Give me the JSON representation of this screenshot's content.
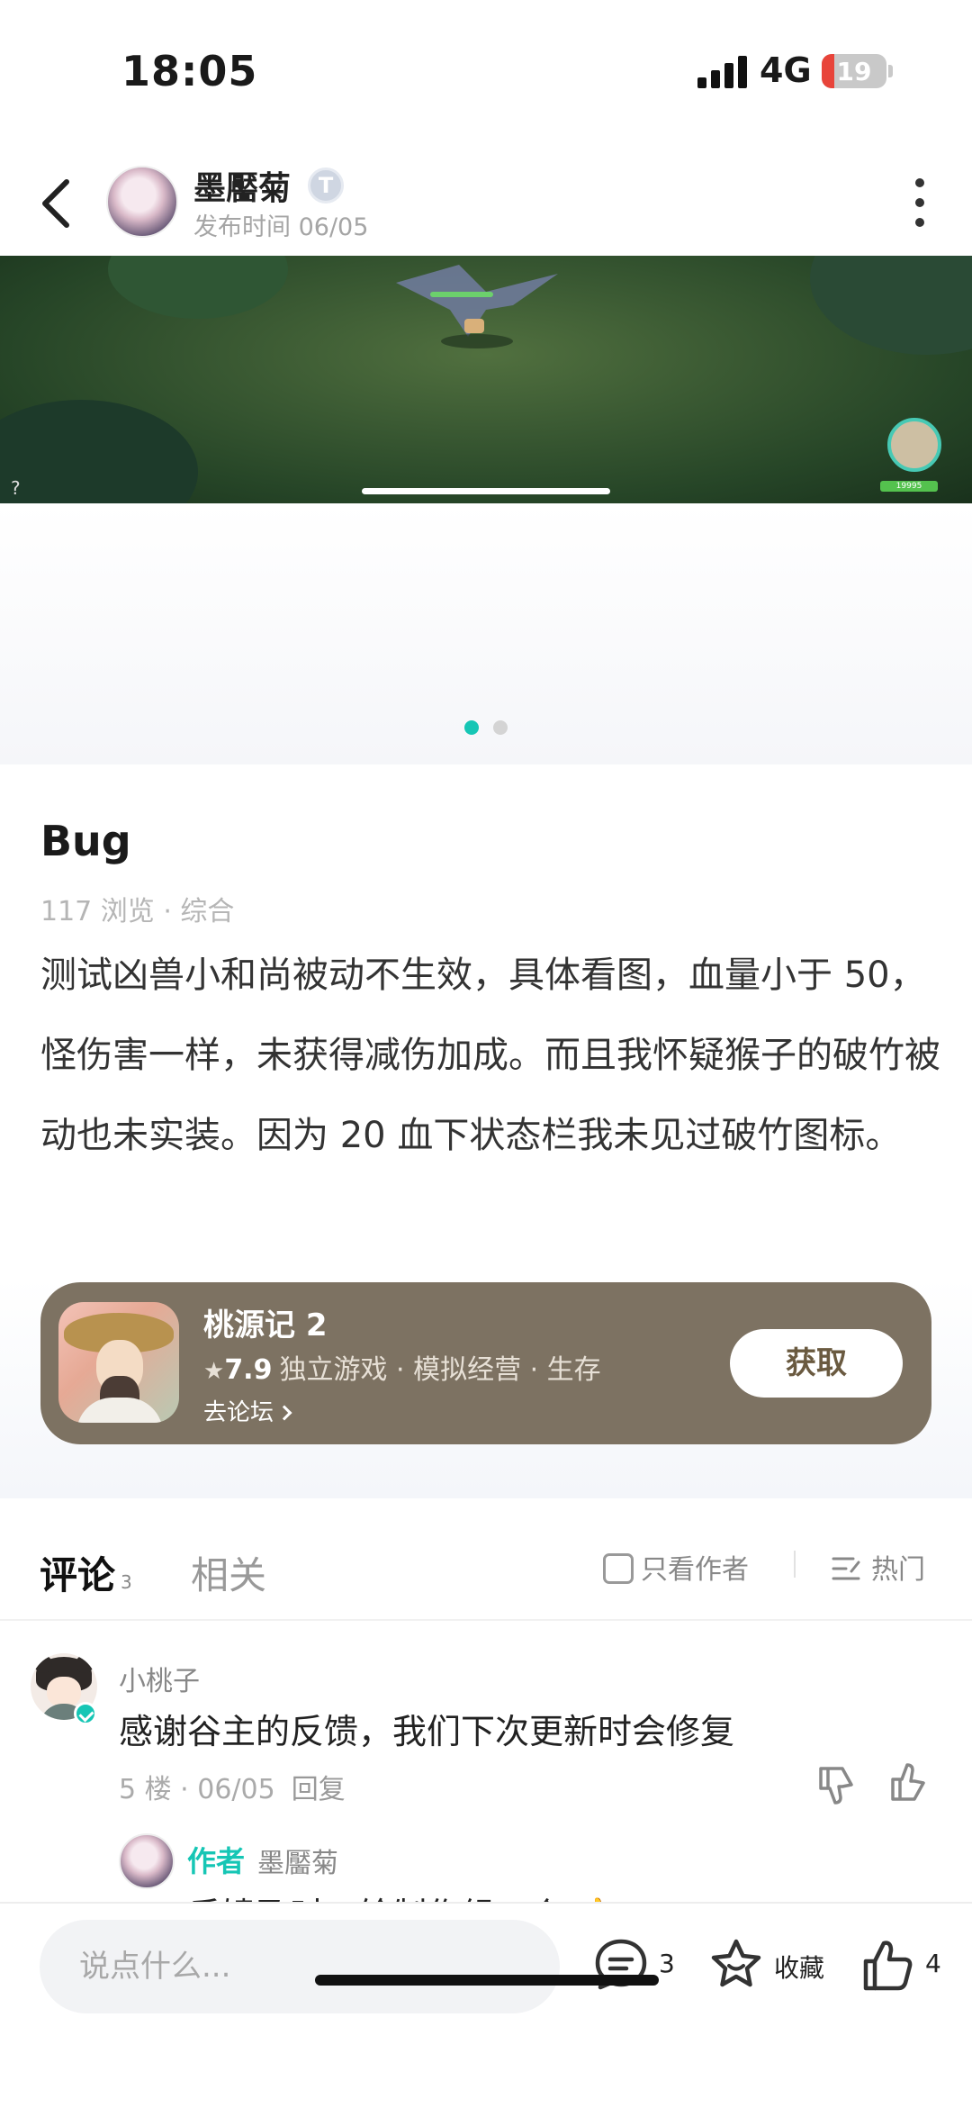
{
  "status_bar": {
    "time": "18:05",
    "network": "4G",
    "battery": "19",
    "battery_level": 0.19
  },
  "header": {
    "author_name": "墨靨菊",
    "author_badge": "T",
    "publish_time": "发布时间 06/05"
  },
  "media": {
    "page_count": 2,
    "active_page": 0,
    "hud_value": "19995",
    "hud_help": "?"
  },
  "post": {
    "title": "Bug",
    "meta": "117 浏览 · 综合",
    "body": "测试凶兽小和尚被动不生效，具体看图，血量小于 50，怪伤害一样，未获得减伤加成。而且我怀疑猴子的破竹被动也未实装。因为 20 血下状态栏我未见过破竹图标。"
  },
  "game_card": {
    "name": "桃源记 2",
    "rating": "7.9",
    "tags": "独立游戏 · 模拟经营 · 生存",
    "forum_link": "去论坛",
    "get_label": "获取",
    "background_color": "#7d7262"
  },
  "tabs": {
    "comments_label": "评论",
    "comments_count": "3",
    "related_label": "相关",
    "author_only_label": "只看作者",
    "sort_label": "热门",
    "accent_color": "#16c6b5"
  },
  "comments": [
    {
      "user": "小桃子",
      "text": "感谢谷主的反馈，我们下次更新时会修复",
      "meta": "5 楼 · 06/05",
      "reply_label": "回复",
      "reply": {
        "author_tag": "作者",
        "name": "墨靨菊",
        "text": "反馈及时，绘制作组一个 👍"
      }
    }
  ],
  "bottom_bar": {
    "input_placeholder": "说点什么...",
    "comment_count": "3",
    "favorite_label": "收藏",
    "like_count": "4"
  }
}
